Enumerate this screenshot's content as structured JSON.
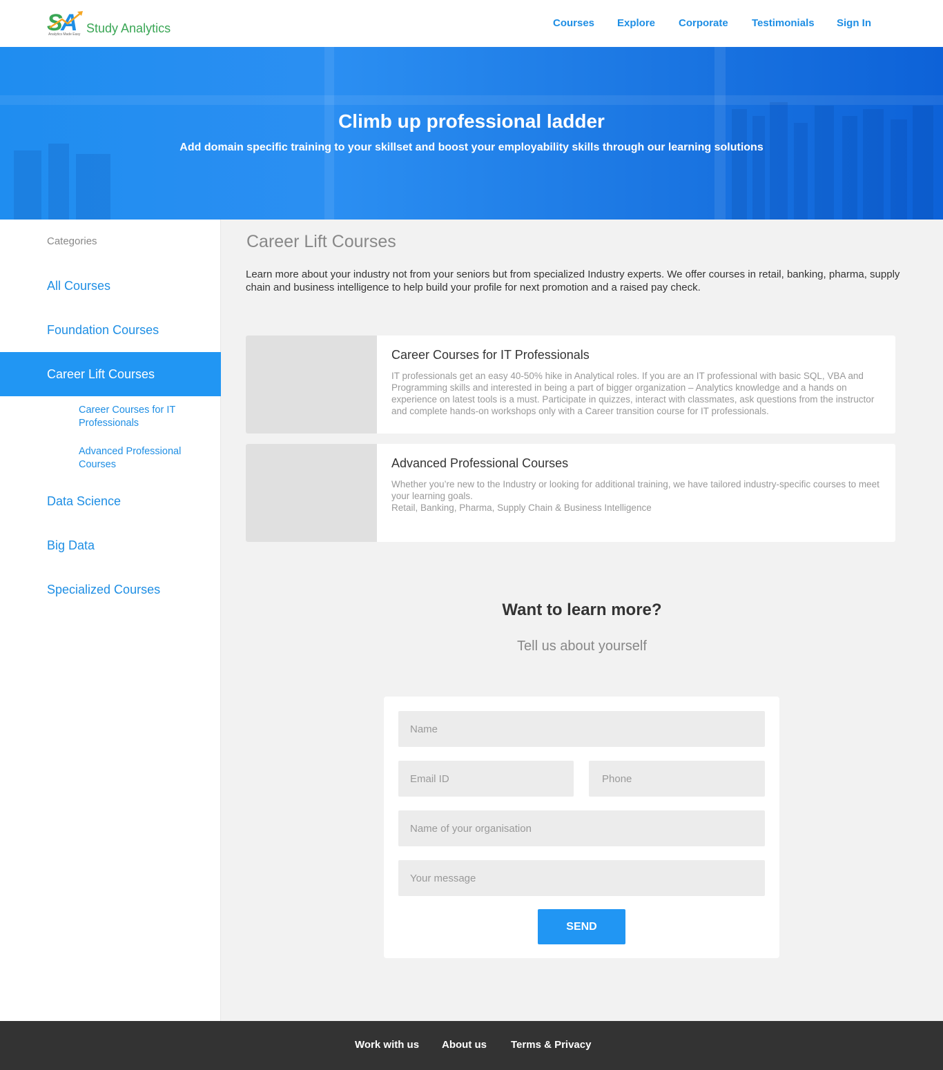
{
  "brand": {
    "logo_letters": "SA",
    "name": "Study Analytics",
    "tagline": "Analytics Made Easy",
    "colors": {
      "green": "#3aa655",
      "blue": "#1e8ee4",
      "orange": "#f5a623"
    }
  },
  "nav": {
    "items": [
      "Courses",
      "Explore",
      "Corporate",
      "Testimonials",
      "Sign In"
    ]
  },
  "hero": {
    "title": "Climb up professional ladder",
    "subtitle": "Add domain specific training to your skillset and boost your employability skills through our learning solutions"
  },
  "sidebar": {
    "heading": "Categories",
    "items": [
      {
        "label": "All Courses",
        "active": false
      },
      {
        "label": "Foundation Courses",
        "active": false
      },
      {
        "label": "Career Lift Courses",
        "active": true
      },
      {
        "label": "Data Science",
        "active": false
      },
      {
        "label": "Big Data",
        "active": false
      },
      {
        "label": "Specialized Courses",
        "active": false
      }
    ],
    "subitems": [
      "Career Courses for IT Professionals",
      "Advanced Professional Courses"
    ]
  },
  "main": {
    "title": "Career Lift Courses",
    "description": "Learn more about your industry not from your seniors but from specialized Industry experts. We offer courses in retail, banking, pharma, supply chain and business intelligence to help build your profile for next promotion and a raised pay check.",
    "cards": [
      {
        "title": "Career Courses for IT Professionals",
        "description": "IT professionals get an easy 40-50% hike in Analytical roles. If you are an IT professional with basic SQL, VBA and Programming skills and interested in being a part of bigger organization – Analytics knowledge and a hands on experience on latest tools is a must. Participate in quizzes, interact with classmates, ask questions from the instructor and complete hands-on workshops only with a Career transition course for IT professionals."
      },
      {
        "title": "Advanced Professional Courses",
        "description": "Whether you’re new to the Industry or looking for additional training, we have tailored industry-specific courses to meet your learning goals.",
        "description_2": "Retail, Banking, Pharma, Supply Chain & Business Intelligence"
      }
    ]
  },
  "cta": {
    "title": "Want to learn more?",
    "subtitle": "Tell us about yourself"
  },
  "form": {
    "name_placeholder": "Name",
    "email_placeholder": "Email ID",
    "phone_placeholder": "Phone",
    "org_placeholder": "Name of your organisation",
    "message_placeholder": "Your message",
    "send_label": "SEND"
  },
  "footer": {
    "links": [
      "Work with us",
      "About us",
      "Terms & Privacy"
    ]
  },
  "colors": {
    "accent": "#2196f3",
    "footer_bg": "#333333",
    "page_bg": "#f2f2f2"
  }
}
